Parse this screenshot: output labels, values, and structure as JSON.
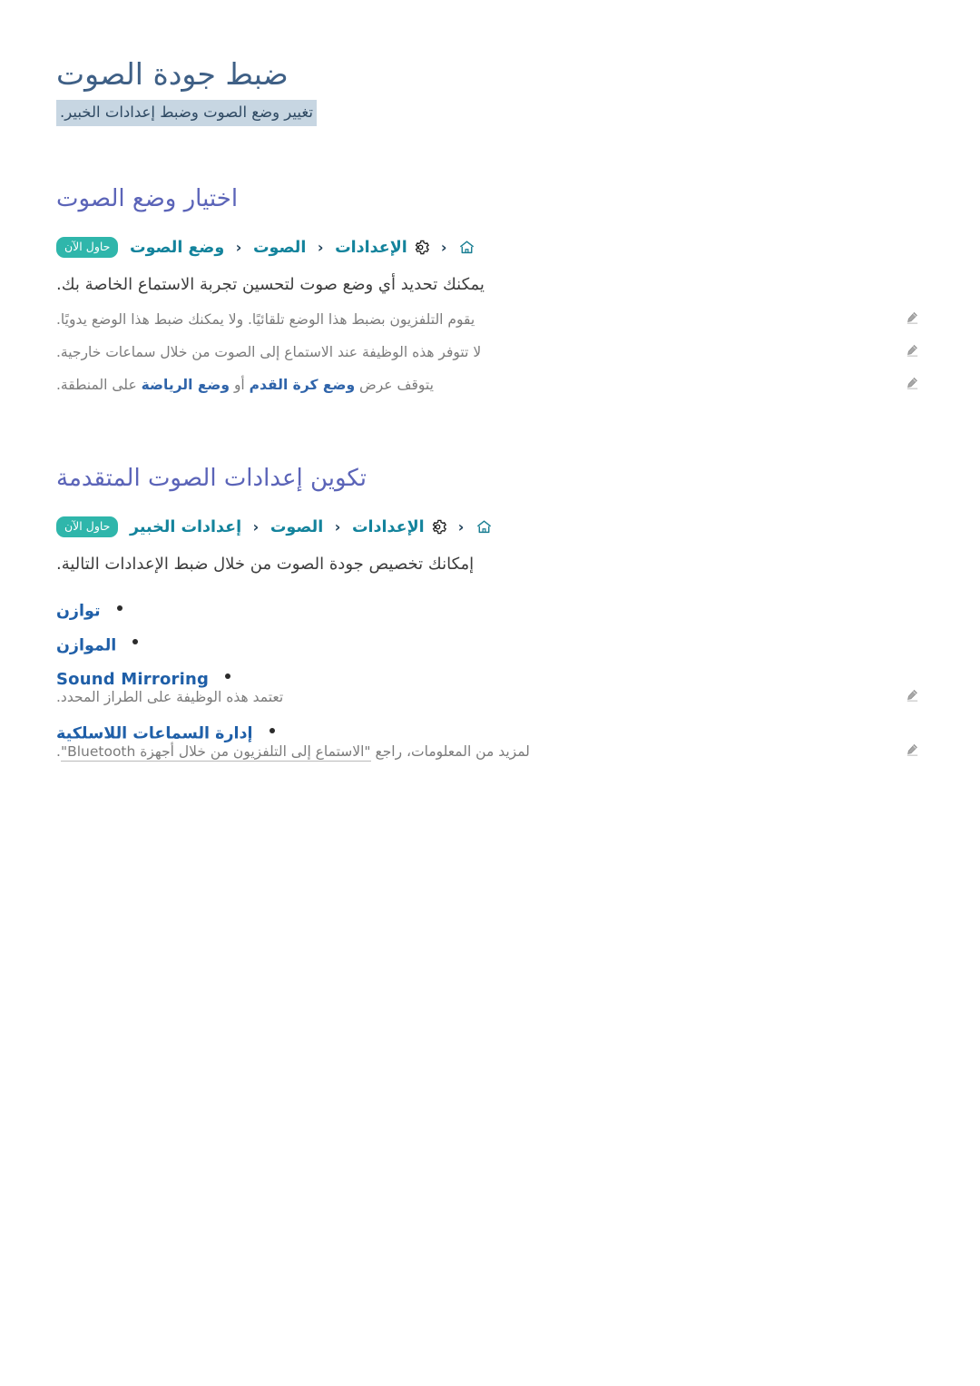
{
  "document": {
    "title": "ضبط جودة الصوت",
    "subtitle": "تغيير وضع الصوت وضبط إعدادات الخبير.",
    "accent_title_color": "#3f6086",
    "accent_heading_color": "#5b64b8",
    "accent_path_color": "#13839c",
    "accent_link_color": "#1f5fa8",
    "badge_color": "#2fb6ab",
    "subtitle_highlight_color": "#c7d6e2"
  },
  "sections": [
    {
      "heading": "اختيار وضع الصوت",
      "path": {
        "home_icon": "home-icon",
        "gear_icon": "gear-icon",
        "separator": "‹",
        "segments": [
          "الإعدادات",
          "الصوت",
          "وضع الصوت"
        ],
        "badge": "حاول الآن"
      },
      "body": "يمكنك تحديد أي وضع صوت لتحسين تجربة الاستماع الخاصة بك.",
      "notes": [
        {
          "icon": "pencil-icon",
          "parts": [
            {
              "text": "يقوم التلفزيون بضبط هذا الوضع تلقائيًا. ولا يمكنك ضبط هذا الوضع يدويًا.",
              "style": "plain"
            }
          ]
        },
        {
          "icon": "pencil-icon",
          "parts": [
            {
              "text": "لا تتوفر هذه الوظيفة عند الاستماع إلى الصوت من خلال سماعات خارجية.",
              "style": "plain"
            }
          ]
        },
        {
          "icon": "pencil-icon",
          "parts": [
            {
              "text": "يتوقف عرض ",
              "style": "plain"
            },
            {
              "text": "وضع كرة القدم",
              "style": "highlight"
            },
            {
              "text": " أو ",
              "style": "plain"
            },
            {
              "text": "وضع الرياضة",
              "style": "highlight"
            },
            {
              "text": " على المنطقة.",
              "style": "plain"
            }
          ]
        }
      ]
    },
    {
      "heading": "تكوين إعدادات الصوت المتقدمة",
      "path": {
        "home_icon": "home-icon",
        "gear_icon": "gear-icon",
        "separator": "‹",
        "segments": [
          "الإعدادات",
          "الصوت",
          "إعدادات الخبير"
        ],
        "badge": "حاول الآن"
      },
      "body": "إمكانك تخصيص جودة الصوت من خلال ضبط الإعدادات التالية.",
      "bullets": [
        {
          "label": "توازن",
          "script": "arabic",
          "note": null
        },
        {
          "label": "الموازن",
          "script": "arabic",
          "note": null
        },
        {
          "label": "Sound Mirroring",
          "script": "latin",
          "note": {
            "icon": "pencil-icon",
            "parts": [
              {
                "text": "تعتمد هذه الوظيفة على الطراز المحدد.",
                "style": "plain"
              }
            ]
          }
        },
        {
          "label": "إدارة السماعات اللاسلكية",
          "script": "arabic",
          "note": {
            "icon": "pencil-icon",
            "parts": [
              {
                "text": "لمزيد من المعلومات، راجع ",
                "style": "plain"
              },
              {
                "text": "\"الاستماع إلى التلفزيون من خلال أجهزة Bluetooth\"",
                "style": "xref"
              },
              {
                "text": ".",
                "style": "plain"
              }
            ]
          }
        }
      ]
    }
  ]
}
